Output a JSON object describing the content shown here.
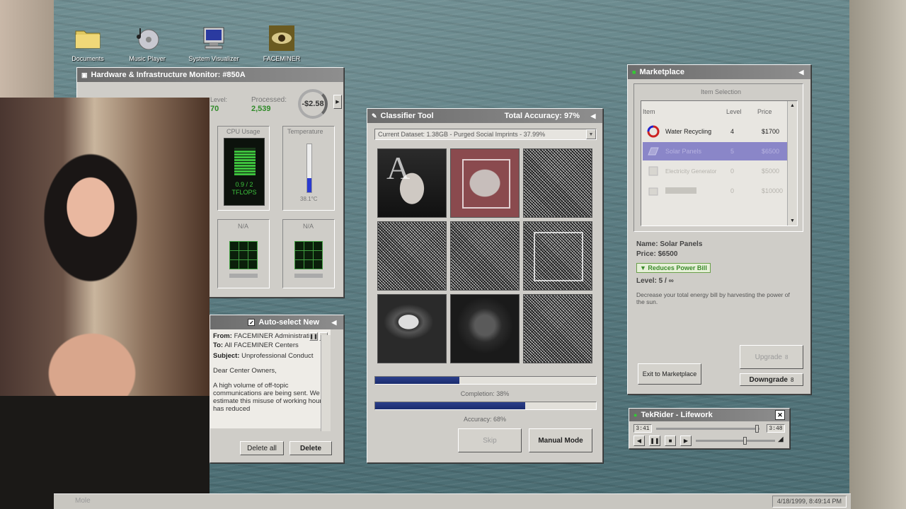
{
  "desktop_icons": [
    {
      "label": "Documents",
      "icon": "folder-icon"
    },
    {
      "label": "Music Player",
      "icon": "music-cd-icon"
    },
    {
      "label": "System Visualizer",
      "icon": "computer-icon"
    },
    {
      "label": "FACEMINER",
      "icon": "eye-icon"
    }
  ],
  "hw_monitor": {
    "title": "Hardware & Infrastructure Monitor: #850A",
    "level_label": "Level:",
    "level_value": "70",
    "processed_label": "Processed:",
    "processed_value": "2,539",
    "balance": "-$2.58",
    "cpu_label": "CPU Usage",
    "cpu_value": "0.9 / 2",
    "cpu_unit": "TFLOPS",
    "cpu_fraction": 0.45,
    "temp_label": "Temperature",
    "temp_value": "38.1°C",
    "temp_fraction": 0.3,
    "slot_a_label": "N/A",
    "slot_b_label": "N/A"
  },
  "classifier": {
    "title": "Classifier Tool",
    "total_accuracy": "Total Accuracy: 97%",
    "dataset": "Current Dataset: 1.38GB - Purged Social Imprints - 37.99%",
    "tiles": [
      "face",
      "statue",
      "noise",
      "noise",
      "noise",
      "noise",
      "face",
      "face",
      "noise"
    ],
    "selected_tiles": [
      1,
      5
    ],
    "progress_top": 0.38,
    "completion_label": "Completion: 38%",
    "completion": 0.68,
    "accuracy_label": "Accuracy: 68%",
    "skip_label": "Skip",
    "manual_label": "Manual Mode"
  },
  "marketplace": {
    "title": "Marketplace",
    "section_label": "Item Selection",
    "col_item": "Item",
    "col_level": "Level",
    "col_price": "Price",
    "items": [
      {
        "name": "Water Recycling",
        "level": "4",
        "price": "$1700",
        "icon": "water-recycling-icon",
        "state": "normal"
      },
      {
        "name": "Solar Panels",
        "level": "5",
        "price": "$6500",
        "icon": "solar-panel-icon",
        "state": "selected"
      },
      {
        "name": "Electricity Generator",
        "level": "0",
        "price": "$5000",
        "icon": "generator-icon",
        "state": "disabled"
      },
      {
        "name": "",
        "level": "0",
        "price": "$10000",
        "icon": "locked-item-icon",
        "state": "locked"
      }
    ],
    "detail_name": "Name: Solar Panels",
    "detail_price": "Price: $6500",
    "detail_badge": "▼ Reduces Power Bill",
    "detail_level": "Level: 5 / ∞",
    "detail_desc": "Decrease your total energy bill by harvesting the power of the sun.",
    "exit_label": "Exit to Marketplace",
    "upgrade_label": "Upgrade",
    "downgrade_label": "Downgrade",
    "upgrade_icon": "8"
  },
  "mail": {
    "title": "Auto-select New",
    "from_label": "From:",
    "from_value": "FACEMINER Administration",
    "to_label": "To:",
    "to_value": "All FACEMINER Centers",
    "subject_label": "Subject:",
    "subject_value": "Unprofessional Conduct",
    "greeting": "Dear Center Owners,",
    "body": "A high volume of off-topic communications are being sent. We estimate this misuse of working hours has reduced",
    "delete_all_label": "Delete all",
    "delete_label": "Delete"
  },
  "player": {
    "title": "TekRider - Lifework",
    "time_elapsed": "3:41",
    "time_total": "3:48",
    "progress": 0.96,
    "volume": 0.6
  },
  "taskbar": {
    "clock": "4/18/1999, 8:49:14 PM",
    "ghost_label": "Mole"
  },
  "colors": {
    "titlebar": "#7a7a7a",
    "accent_blue": "#1f2f72",
    "green_text": "#2f8a28",
    "selected_row": "#8a86c8"
  }
}
